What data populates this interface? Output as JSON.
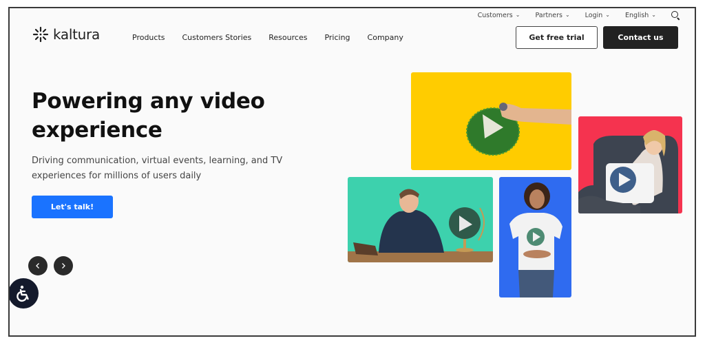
{
  "topbar": {
    "items": [
      {
        "label": "Customers",
        "icon": "chevron-down-icon"
      },
      {
        "label": "Partners",
        "icon": "chevron-down-icon"
      },
      {
        "label": "Login",
        "icon": "chevron-down-icon"
      },
      {
        "label": "English",
        "icon": "chevron-down-icon"
      }
    ],
    "search_icon": "search-icon",
    "chevron": "⌄"
  },
  "header": {
    "logo_text": "kaltura",
    "logo_icon": "kaltura-burst-icon",
    "nav": [
      "Products",
      "Customers Stories",
      "Resources",
      "Pricing",
      "Company"
    ],
    "trial_button": "Get free trial",
    "contact_button": "Contact us"
  },
  "hero": {
    "title": "Powering any video experience",
    "subtitle": "Driving communication, virtual events, learning, and TV experiences for millions of users daily",
    "cta": "Let's talk!"
  },
  "carousel": {
    "prev_icon": "chevron-left-icon",
    "next_icon": "chevron-right-icon"
  },
  "accessibility": {
    "icon": "accessibility-icon"
  },
  "tiles": [
    {
      "name": "hand-drawing-play-tile",
      "bg": "#ffcc00"
    },
    {
      "name": "woman-armchair-tile",
      "bg": "#f5334f"
    },
    {
      "name": "man-desk-globe-tile",
      "bg": "#3dd1ad"
    },
    {
      "name": "woman-tshirt-tile",
      "bg": "#2f6bf0"
    }
  ],
  "colors": {
    "primary_blue": "#1a73ff",
    "dark": "#222222",
    "background": "#fafafa"
  }
}
